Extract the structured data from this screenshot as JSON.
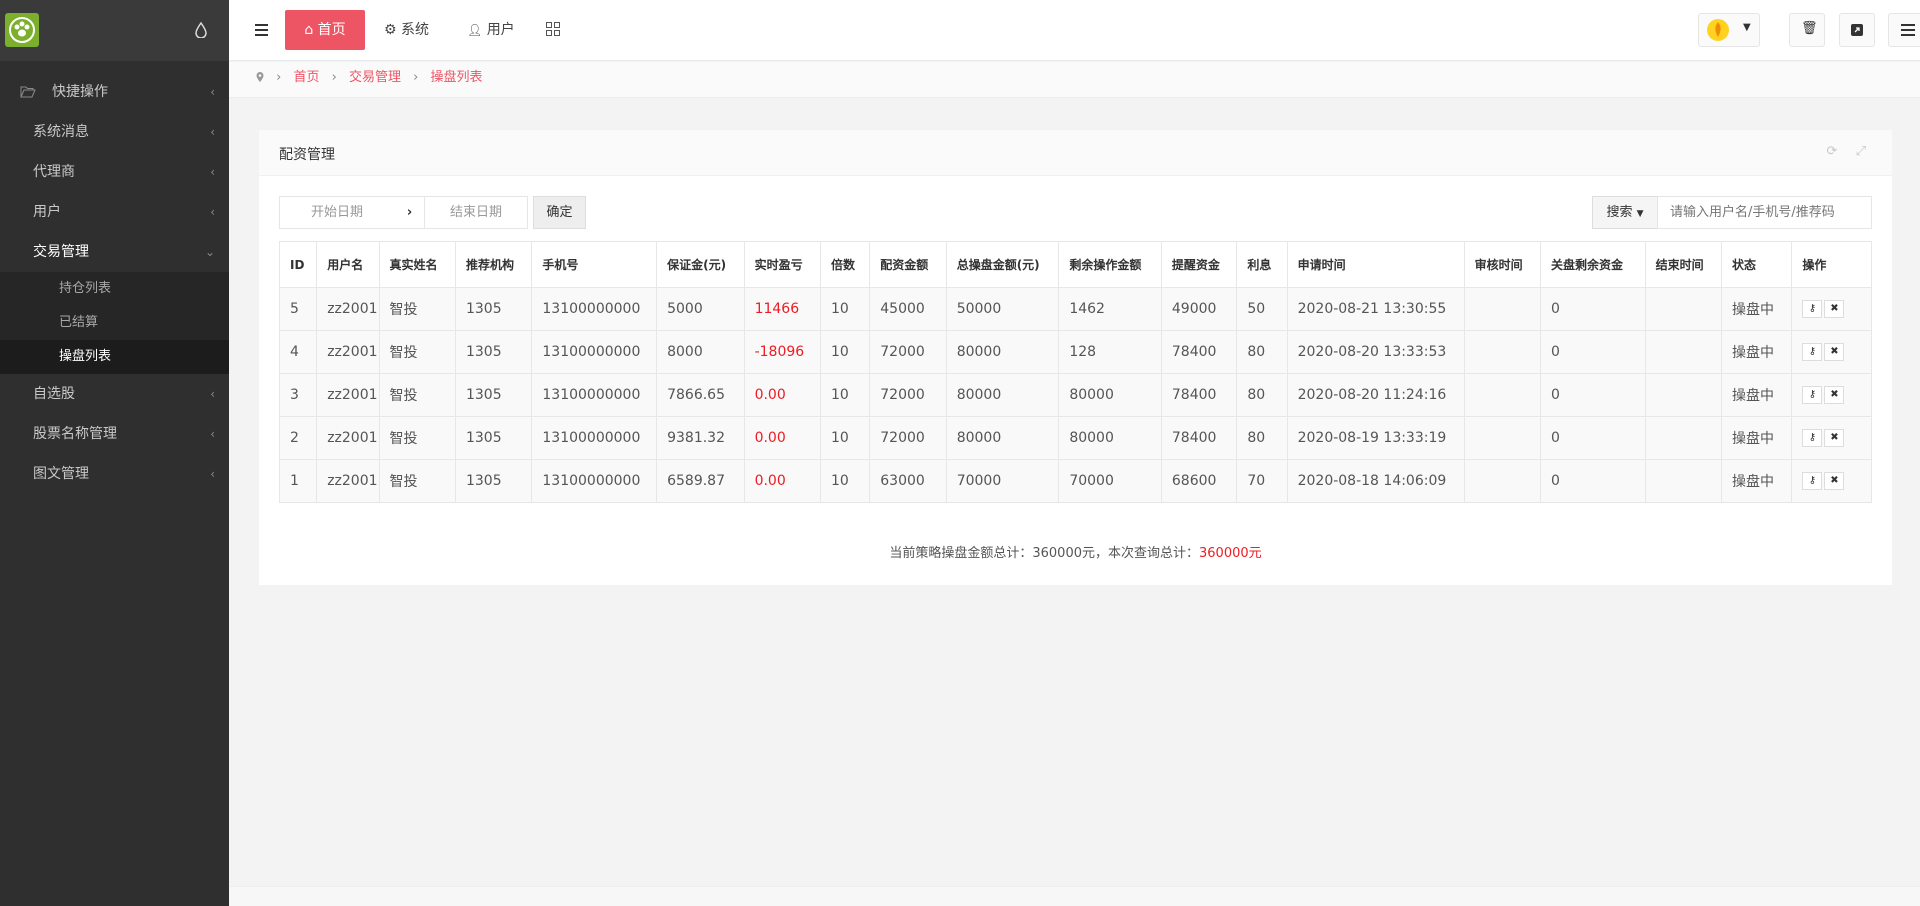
{
  "sidebar": {
    "items": [
      {
        "label": "快捷操作"
      },
      {
        "label": "系统消息"
      },
      {
        "label": "代理商"
      },
      {
        "label": "用户"
      },
      {
        "label": "交易管理"
      },
      {
        "label": "自选股"
      },
      {
        "label": "股票名称管理"
      },
      {
        "label": "图文管理"
      }
    ],
    "sub_items": [
      {
        "label": "持仓列表"
      },
      {
        "label": "已结算"
      },
      {
        "label": "操盘列表"
      }
    ]
  },
  "topbar": {
    "home": "首页",
    "system": "系统",
    "user": "用户"
  },
  "breadcrumb": {
    "items": [
      "首页",
      "交易管理",
      "操盘列表"
    ]
  },
  "panel": {
    "title": "配资管理",
    "start_date_placeholder": "开始日期",
    "end_date_placeholder": "结束日期",
    "confirm": "确定",
    "search_label": "搜索",
    "search_placeholder": "请输入用户名/手机号/推荐码"
  },
  "table": {
    "headers": [
      "ID",
      "用户名",
      "真实姓名",
      "推荐机构",
      "手机号",
      "保证金(元)",
      "实时盈亏",
      "倍数",
      "配资金额",
      "总操盘金额(元)",
      "剩余操作金额",
      "提醒资金",
      "利息",
      "申请时间",
      "审核时间",
      "关盘剩余资金",
      "结束时间",
      "状态",
      "操作"
    ],
    "rows": [
      [
        "5",
        "zz2001",
        "智投",
        "1305",
        "13100000000",
        "5000",
        "11466",
        "10",
        "45000",
        "50000",
        "1462",
        "49000",
        "50",
        "2020-08-21 13:30:55",
        "",
        "0",
        "",
        "操盘中"
      ],
      [
        "4",
        "zz2001",
        "智投",
        "1305",
        "13100000000",
        "8000",
        "-18096",
        "10",
        "72000",
        "80000",
        "128",
        "78400",
        "80",
        "2020-08-20 13:33:53",
        "",
        "0",
        "",
        "操盘中"
      ],
      [
        "3",
        "zz2001",
        "智投",
        "1305",
        "13100000000",
        "7866.65",
        "0.00",
        "10",
        "72000",
        "80000",
        "80000",
        "78400",
        "80",
        "2020-08-20 11:24:16",
        "",
        "0",
        "",
        "操盘中"
      ],
      [
        "2",
        "zz2001",
        "智投",
        "1305",
        "13100000000",
        "9381.32",
        "0.00",
        "10",
        "72000",
        "80000",
        "80000",
        "78400",
        "80",
        "2020-08-19 13:33:19",
        "",
        "0",
        "",
        "操盘中"
      ],
      [
        "1",
        "zz2001",
        "智投",
        "1305",
        "13100000000",
        "6589.87",
        "0.00",
        "10",
        "63000",
        "70000",
        "70000",
        "68600",
        "70",
        "2020-08-18 14:06:09",
        "",
        "0",
        "",
        "操盘中"
      ]
    ]
  },
  "summary": {
    "prefix": "当前策略操盘金额总计：360000元，本次查询总计：",
    "total": "360000元"
  },
  "colors": {
    "accent": "#ed5565",
    "loss_gain": "#ed1c24",
    "sidebar_bg": "#2f2f2f"
  }
}
